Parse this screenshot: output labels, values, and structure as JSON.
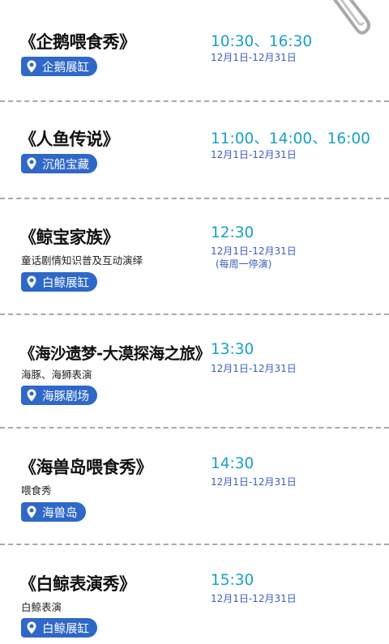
{
  "shows": [
    {
      "title": "《企鹅喂食秀》",
      "description": "",
      "location": "企鹅展缸",
      "time": "10:30、16:30",
      "dates": "12月1日-12月31日",
      "note": ""
    },
    {
      "title": "《人鱼传说》",
      "description": "",
      "location": "沉船宝藏",
      "time": "11:00、14:00、16:00",
      "dates": "12月1日-12月31日",
      "note": ""
    },
    {
      "title": "《鲸宝家族》",
      "description": "童话剧情知识普及互动演绎",
      "location": "白鲸展缸",
      "time": "12:30",
      "dates": "12月1日-12月31日",
      "note": "(每周一停演)"
    },
    {
      "title": "《海沙遗梦-大漠探海之旅》",
      "description": "海豚、海狮表演",
      "location": "海豚剧场",
      "time": "13:30",
      "dates": "12月1日-12月31日",
      "note": ""
    },
    {
      "title": "《海兽岛喂食秀》",
      "description": "喂食秀",
      "location": "海兽岛",
      "time": "14:30",
      "dates": "12月1日-12月31日",
      "note": ""
    },
    {
      "title": "《白鲸表演秀》",
      "description": "白鲸表演",
      "location": "白鲸展缸",
      "time": "15:30",
      "dates": "12月1日-12月31日",
      "note": ""
    }
  ],
  "icons": {
    "location": "location-pin-icon",
    "decoration": "paperclip-icon"
  },
  "colors": {
    "badge": "#2f68c8",
    "time": "#1aa0c8",
    "dates": "#3a5fb8",
    "divider": "#a9a9a9"
  }
}
